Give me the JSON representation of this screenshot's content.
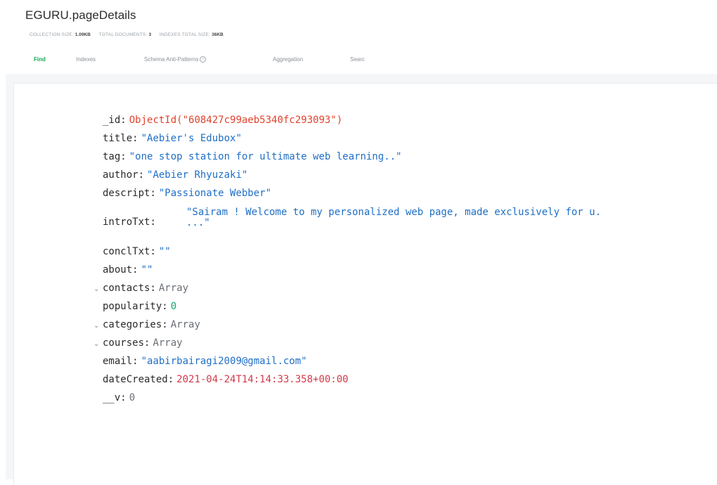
{
  "header": {
    "namespace": "EGURU.pageDetails",
    "stats": [
      {
        "label": "Collection size:",
        "value": "1.09KB"
      },
      {
        "label": "Total documents:",
        "value": "3"
      },
      {
        "label": "Indexes total size:",
        "value": "36KB"
      }
    ],
    "tabs": [
      {
        "label": "Find",
        "active": true
      },
      {
        "label": "Indexes",
        "active": false
      },
      {
        "label": "Schema Anti-Patterns",
        "active": false
      },
      {
        "label": "Aggregation",
        "active": false
      },
      {
        "label": "Searc",
        "active": false
      }
    ]
  },
  "document": {
    "fields": [
      {
        "key": "_id",
        "value": "ObjectId(\"608427c99aeb5340fc293093\")",
        "type": "oid"
      },
      {
        "key": "title",
        "value": "\"Aebier's Edubox\"",
        "type": "string"
      },
      {
        "key": "tag",
        "value": "\"one stop station for ultimate web learning..\"",
        "type": "string"
      },
      {
        "key": "author",
        "value": "\"Aebier Rhyuzaki\"",
        "type": "string"
      },
      {
        "key": "descript",
        "value": "\"Passionate Webber\"",
        "type": "string"
      },
      {
        "key": "introTxt",
        "value_line1": "\"Sairam ! Welcome to my personalized web page, made exclusively for u.",
        "value_line2": "...\"",
        "type": "string"
      },
      {
        "key": "conclTxt",
        "value": "\"\"",
        "type": "string"
      },
      {
        "key": "about",
        "value": "\"\"",
        "type": "string"
      },
      {
        "key": "contacts",
        "value": "Array",
        "type": "array"
      },
      {
        "key": "popularity",
        "value": "0",
        "type": "number"
      },
      {
        "key": "categories",
        "value": "Array",
        "type": "array"
      },
      {
        "key": "courses",
        "value": "Array",
        "type": "array"
      },
      {
        "key": "email",
        "value": "\"aabirbairagi2009@gmail.com\"",
        "type": "string"
      },
      {
        "key": "dateCreated",
        "value": "2021-04-24T14:14:33.358+00:00",
        "type": "date"
      },
      {
        "key": "__v",
        "value": "0",
        "type": "number"
      }
    ]
  },
  "colors": {
    "active_tab": "#13aa52",
    "string": "#1f6fc5",
    "objectid": "#e0432e",
    "date": "#d23a4a",
    "number": "#14a86b"
  }
}
